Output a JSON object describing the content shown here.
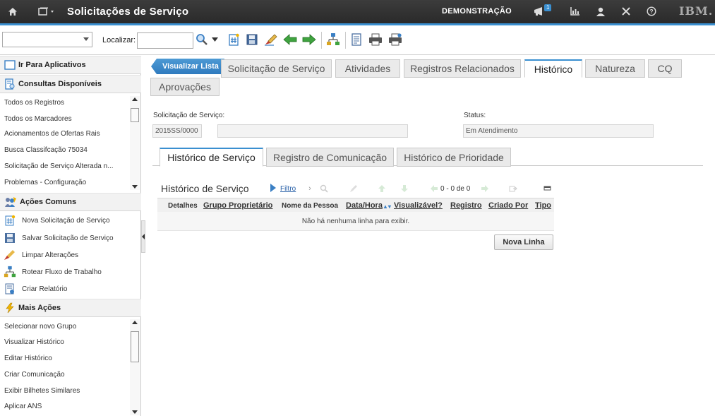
{
  "header": {
    "title": "Solicitações de Serviço",
    "user_label": "DEMONSTRAÇÃO",
    "message_count": "1",
    "brand": "IBM.",
    "accent_color": "#3a8fd0",
    "icons": [
      "home-icon",
      "go-to-menu-icon",
      "messages-icon",
      "reports-icon",
      "profile-icon",
      "close-icon",
      "help-icon"
    ]
  },
  "toolbar": {
    "app_select_value": "",
    "find_label": "Localizar:",
    "find_value": "",
    "icons": [
      "search-icon",
      "search-options-icon",
      "new-record-icon",
      "save-icon",
      "clear-changes-icon",
      "previous-icon",
      "next-icon",
      "workflow-icon",
      "report-icon",
      "print-icon",
      "print-options-icon"
    ]
  },
  "sidebar": {
    "go_to_apps": "Ir Para Aplicativos",
    "queries_title": "Consultas Disponíveis",
    "queries": [
      "Todos os Registros",
      "Todos os Marcadores",
      "Acionamentos de Ofertas Rais",
      "Busca Classifcação 75034",
      "Solicitação de Serviço Alterada n...",
      "Problemas - Configuração"
    ],
    "common_actions_title": "Ações Comuns",
    "common_actions": [
      "Nova Solicitação de Serviço",
      "Salvar Solicitação de Serviço",
      "Limpar Alterações",
      "Rotear Fluxo de Trabalho",
      "Criar Relatório"
    ],
    "more_actions_title": "Mais Ações",
    "more_actions": [
      "Selecionar novo Grupo",
      "Visualizar Histórico",
      "Editar Histórico",
      "Criar Comunicação",
      "Exibir Bilhetes Similares",
      "Aplicar ANS"
    ]
  },
  "main": {
    "back_to_list": "Visualizar Lista",
    "tabs": [
      "Solicitação de Serviço",
      "Atividades",
      "Registros Relacionados",
      "Histórico",
      "Natureza",
      "CQ",
      "Aprovações"
    ],
    "active_tab": "Histórico",
    "sr_label": "Solicitação de Serviço:",
    "sr_number": "2015SS/0000",
    "sr_description": "",
    "status_label": "Status:",
    "status_value": "Em Atendimento",
    "subtabs": [
      "Histórico de Serviço",
      "Registro de Comunicação",
      "Histórico de Prioridade"
    ],
    "active_subtab": "Histórico de Serviço",
    "table": {
      "title": "Histórico de Serviço",
      "filter_label": "Filtro",
      "count": "0 - 0 de 0",
      "columns": [
        "Detalhes",
        "Grupo Proprietário",
        "Nome da Pessoa",
        "Data/Hora",
        "Visualizável?",
        "Registro",
        "Criado Por",
        "Tipo"
      ],
      "empty_message": "Não há nenhuma linha para exibir.",
      "new_row_label": "Nova Linha"
    }
  }
}
